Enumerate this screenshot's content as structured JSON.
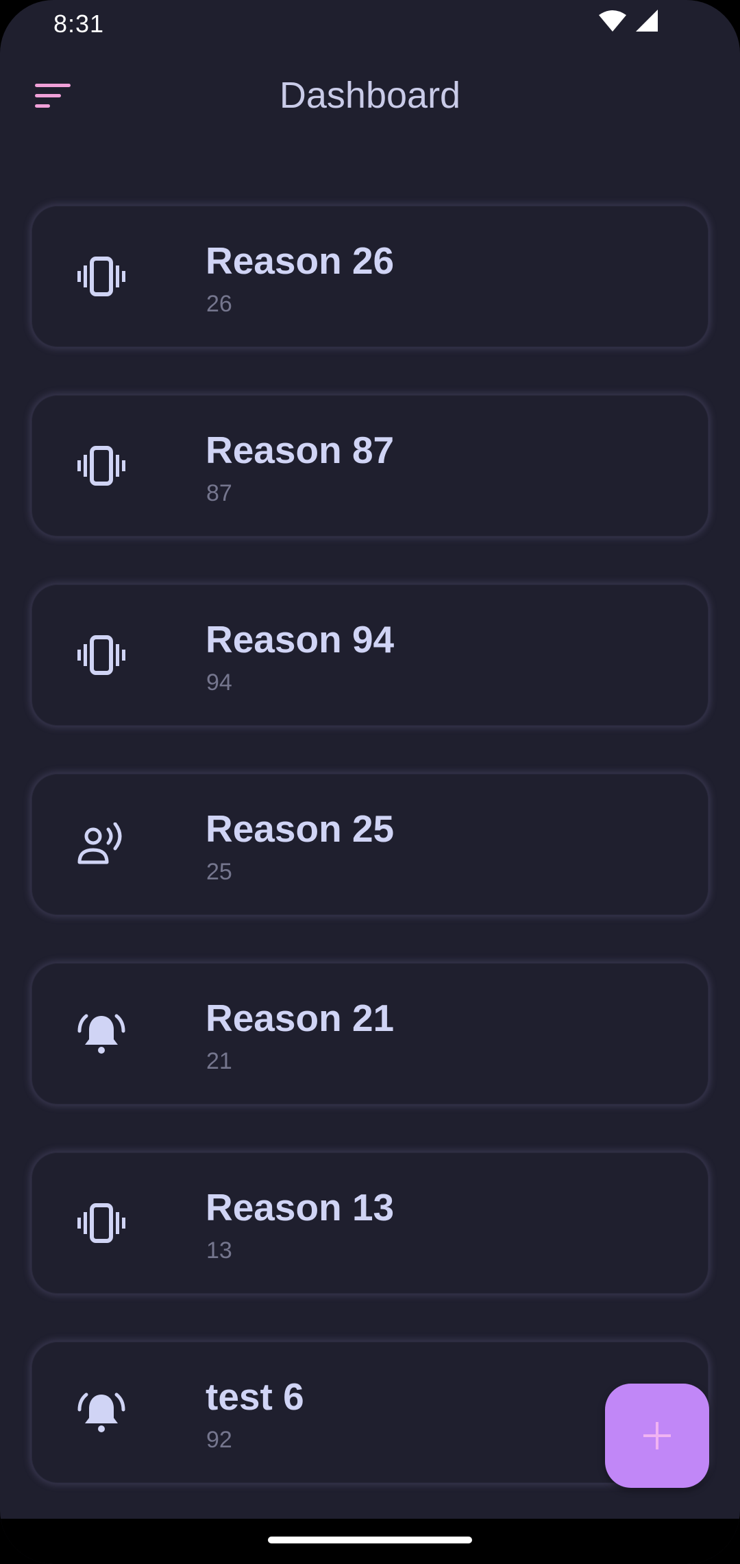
{
  "status_bar": {
    "time": "8:31"
  },
  "app_bar": {
    "title": "Dashboard",
    "menu_icon": "sort-menu-icon"
  },
  "items": [
    {
      "title": "Reason 26",
      "value": "26",
      "icon": "vibration-icon"
    },
    {
      "title": "Reason 87",
      "value": "87",
      "icon": "vibration-icon"
    },
    {
      "title": "Reason 94",
      "value": "94",
      "icon": "vibration-icon"
    },
    {
      "title": "Reason 25",
      "value": "25",
      "icon": "voice-person-icon"
    },
    {
      "title": "Reason 21",
      "value": "21",
      "icon": "ringing-bell-icon"
    },
    {
      "title": "Reason 13",
      "value": "13",
      "icon": "vibration-icon"
    },
    {
      "title": "test 6",
      "value": "92",
      "icon": "ringing-bell-icon"
    }
  ],
  "fab": {
    "icon": "plus-icon"
  },
  "colors": {
    "background": "#1f1f2e",
    "title_text": "#d0d4f5",
    "subtitle_text": "#75768e",
    "accent": "#c187f7",
    "menu_icon": "#f0a0d8"
  }
}
